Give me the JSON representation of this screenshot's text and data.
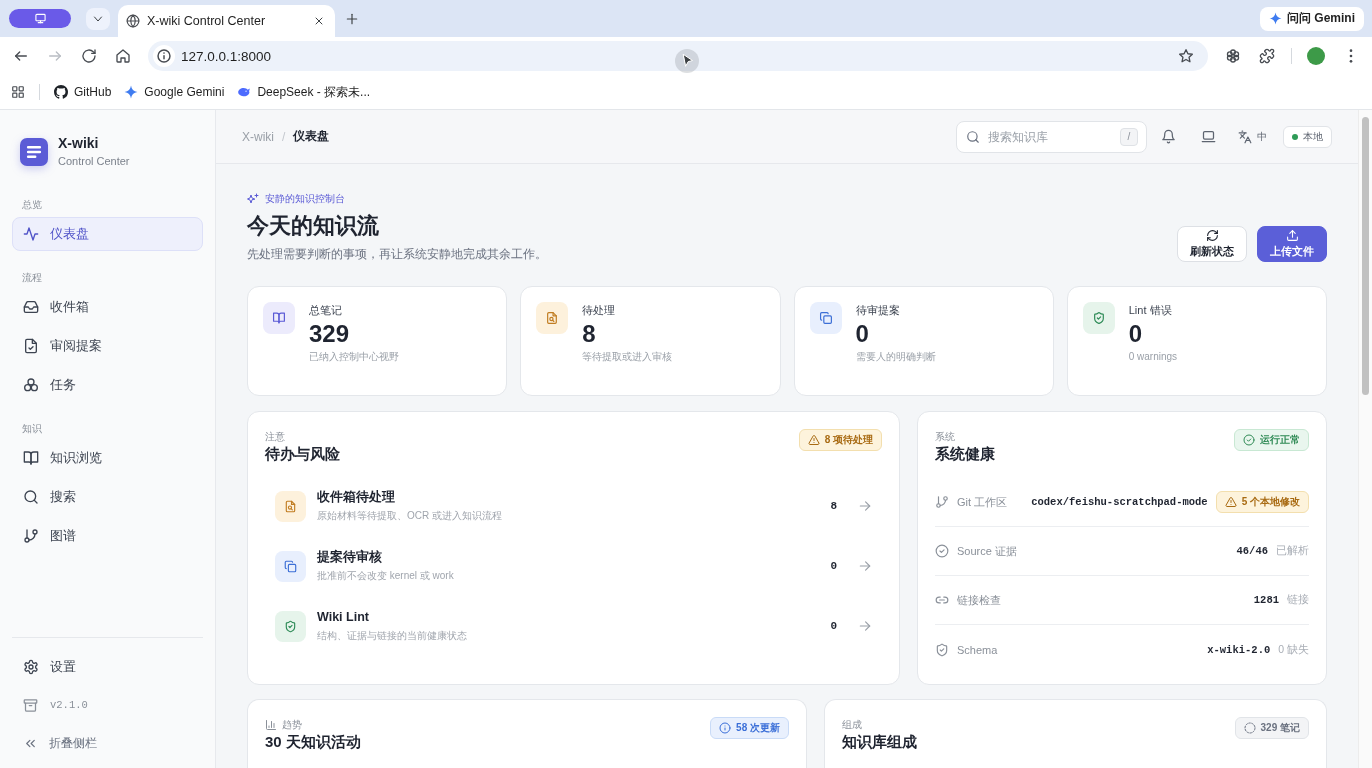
{
  "browser": {
    "tabs": [
      {
        "title": "X-wiki Control Center",
        "selected": true
      }
    ],
    "assistant": "问问 Gemini",
    "nav": [
      {
        "kind": "back",
        "disabled": false
      },
      {
        "kind": "forward",
        "disabled": true
      },
      {
        "kind": "reload",
        "disabled": false
      },
      {
        "kind": "home",
        "disabled": false
      }
    ],
    "address": "127.0.0.1:8000",
    "bookmarks": [
      {
        "kind": "github",
        "label": "GitHub"
      },
      {
        "kind": "gemini",
        "label": "Google Gemini"
      },
      {
        "kind": "deepseek",
        "label": "DeepSeek - 探索未..."
      }
    ]
  },
  "sidebar": {
    "brand": {
      "name": "X-wiki",
      "subtitle": "Control Center"
    },
    "sections": [
      {
        "label": "总览",
        "items": [
          {
            "kind": "dashboard",
            "label": "仪表盘",
            "selected": true
          }
        ]
      },
      {
        "label": "流程",
        "items": [
          {
            "kind": "inbox",
            "label": "收件箱",
            "selected": false
          },
          {
            "kind": "review",
            "label": "审阅提案",
            "selected": false
          },
          {
            "kind": "tasks",
            "label": "任务",
            "selected": false
          }
        ]
      },
      {
        "label": "知识",
        "items": [
          {
            "kind": "browse",
            "label": "知识浏览",
            "selected": false
          },
          {
            "kind": "search",
            "label": "搜索",
            "selected": false
          },
          {
            "kind": "graph",
            "label": "图谱",
            "selected": false
          }
        ]
      }
    ],
    "footer": [
      {
        "kind": "settings",
        "label": "设置"
      },
      {
        "kind": "version",
        "label": "v2.1.0"
      },
      {
        "kind": "collapse",
        "label": "折叠侧栏"
      }
    ]
  },
  "header": {
    "breadcrumb": {
      "items": [
        "X-wiki",
        "仪表盘"
      ],
      "separator": "/"
    },
    "search": {
      "placeholder": "搜索知识库",
      "shortcut": "/"
    },
    "language": "中",
    "mode": "本地"
  },
  "hero": {
    "eyebrow": "安静的知识控制台",
    "title": "今天的知识流",
    "subtitle": "先处理需要判断的事项，再让系统安静地完成其余工作。",
    "actions": [
      {
        "kind": "refresh",
        "label": "刷新状态"
      },
      {
        "kind": "upload",
        "label": "上传文件"
      }
    ]
  },
  "stats": [
    {
      "kind": "notes",
      "label": "总笔记",
      "value": "329",
      "note": "已纳入控制中心视野"
    },
    {
      "kind": "inbox",
      "label": "待处理",
      "value": "8",
      "note": "等待提取或进入审核"
    },
    {
      "kind": "review",
      "label": "待审提案",
      "value": "0",
      "note": "需要人的明确判断"
    },
    {
      "kind": "lint",
      "label": "Lint 错误",
      "value": "0",
      "note": "0 warnings"
    }
  ],
  "todo": {
    "eyebrow": "注意",
    "title": "待办与风险",
    "badge": {
      "kind": "warning",
      "text": "8 项待处理"
    },
    "items": [
      {
        "kind": "inbox",
        "title": "收件箱待处理",
        "description": "原始材料等待提取、OCR 或进入知识流程",
        "count": "8"
      },
      {
        "kind": "review",
        "title": "提案待审核",
        "description": "批准前不会改变 kernel 或 work",
        "count": "0"
      },
      {
        "kind": "lint",
        "title": "Wiki Lint",
        "description": "结构、证据与链接的当前健康状态",
        "count": "0"
      }
    ]
  },
  "health": {
    "eyebrow": "系统",
    "title": "系统健康",
    "badge": {
      "kind": "success",
      "text": "运行正常"
    },
    "rows": [
      {
        "kind": "git",
        "label": "Git 工作区",
        "value": "codex/feishu-scratchpad-mode",
        "badge": {
          "kind": "warning",
          "text": "5 个本地修改"
        }
      },
      {
        "kind": "source",
        "label": "Source 证据",
        "value": "46/46",
        "note": "已解析"
      },
      {
        "kind": "links",
        "label": "链接检查",
        "value": "1281",
        "note": "链接"
      },
      {
        "kind": "schema",
        "label": "Schema",
        "value": "x-wiki-2.0",
        "note": "0 缺失"
      }
    ]
  },
  "panels": [
    {
      "kind": "trend",
      "eyebrow": "趋势",
      "title": "30 天知识活动",
      "badge": {
        "kind": "info",
        "text": "58 次更新"
      }
    },
    {
      "kind": "composition",
      "eyebrow": "组成",
      "title": "知识库组成",
      "badge": {
        "kind": "neutral",
        "text": "329 笔记"
      }
    }
  ]
}
